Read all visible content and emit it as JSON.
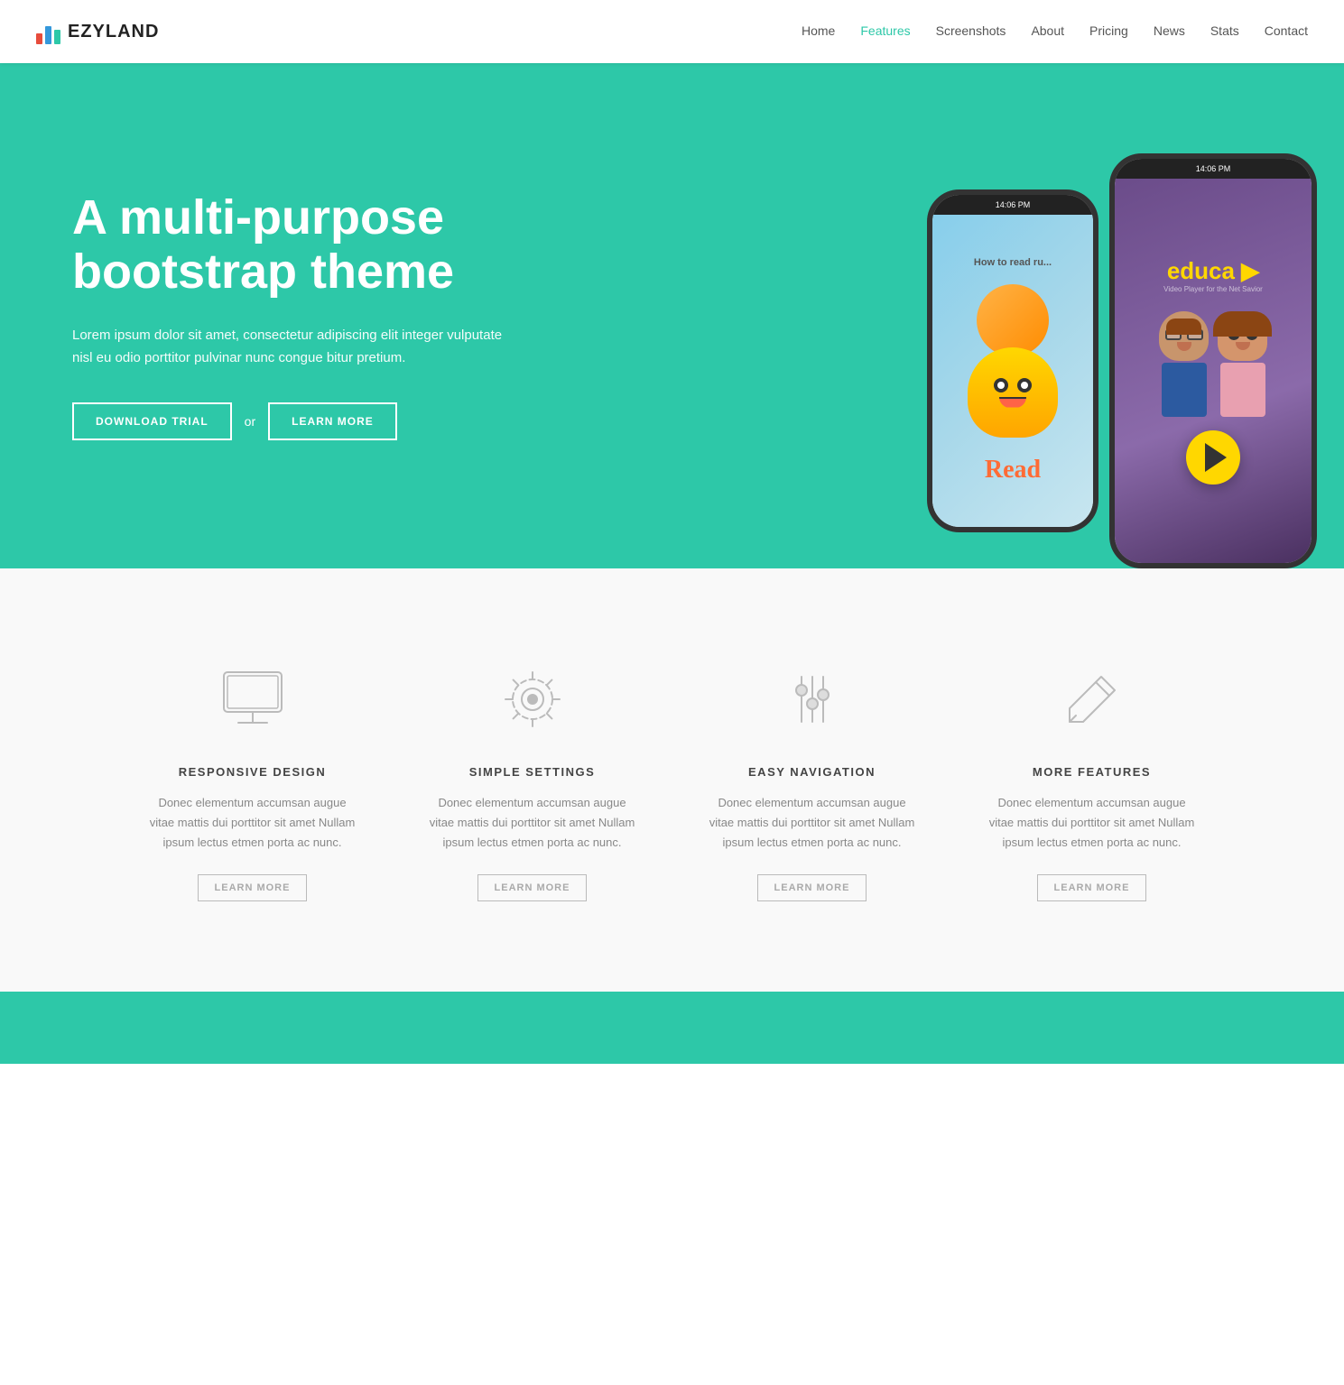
{
  "nav": {
    "logo_text": "EZYLAND",
    "links": [
      {
        "label": "Home",
        "active": false
      },
      {
        "label": "Features",
        "active": true
      },
      {
        "label": "Screenshots",
        "active": false
      },
      {
        "label": "About",
        "active": false
      },
      {
        "label": "Pricing",
        "active": false
      },
      {
        "label": "News",
        "active": false
      },
      {
        "label": "Stats",
        "active": false
      },
      {
        "label": "Contact",
        "active": false
      }
    ]
  },
  "hero": {
    "title": "A multi-purpose bootstrap theme",
    "description": "Lorem ipsum dolor sit amet, consectetur adipiscing elit integer vulputate nisl eu odio porttitor pulvinar nunc congue bitur pretium.",
    "btn_download": "DOWNLOAD TRIAL",
    "btn_or": "or",
    "btn_learn": "LEARN MORE",
    "phone_left_time": "14:06 PM",
    "phone_right_time": "14:06 PM"
  },
  "features": {
    "cards": [
      {
        "icon": "monitor",
        "title": "RESPONSIVE DESIGN",
        "desc": "Donec elementum accumsan augue vitae mattis dui porttitor sit amet Nullam ipsum lectus etmen porta ac nunc.",
        "btn": "LEARN MORE"
      },
      {
        "icon": "gear",
        "title": "SIMPLE SETTINGS",
        "desc": "Donec elementum accumsan augue vitae mattis dui porttitor sit amet Nullam ipsum lectus etmen porta ac nunc.",
        "btn": "LEARN MORE"
      },
      {
        "icon": "sliders",
        "title": "EASY NAVIGATION",
        "desc": "Donec elementum accumsan augue vitae mattis dui porttitor sit amet Nullam ipsum lectus etmen porta ac nunc.",
        "btn": "LEARN MORE"
      },
      {
        "icon": "pencil",
        "title": "MORE FEATURES",
        "desc": "Donec elementum accumsan augue vitae mattis dui porttitor sit amet Nullam ipsum lectus etmen porta ac nunc.",
        "btn": "LEARN MORE"
      }
    ]
  },
  "colors": {
    "teal": "#2dc8a8",
    "dark": "#222",
    "light_text": "#888",
    "border": "#bbb"
  }
}
